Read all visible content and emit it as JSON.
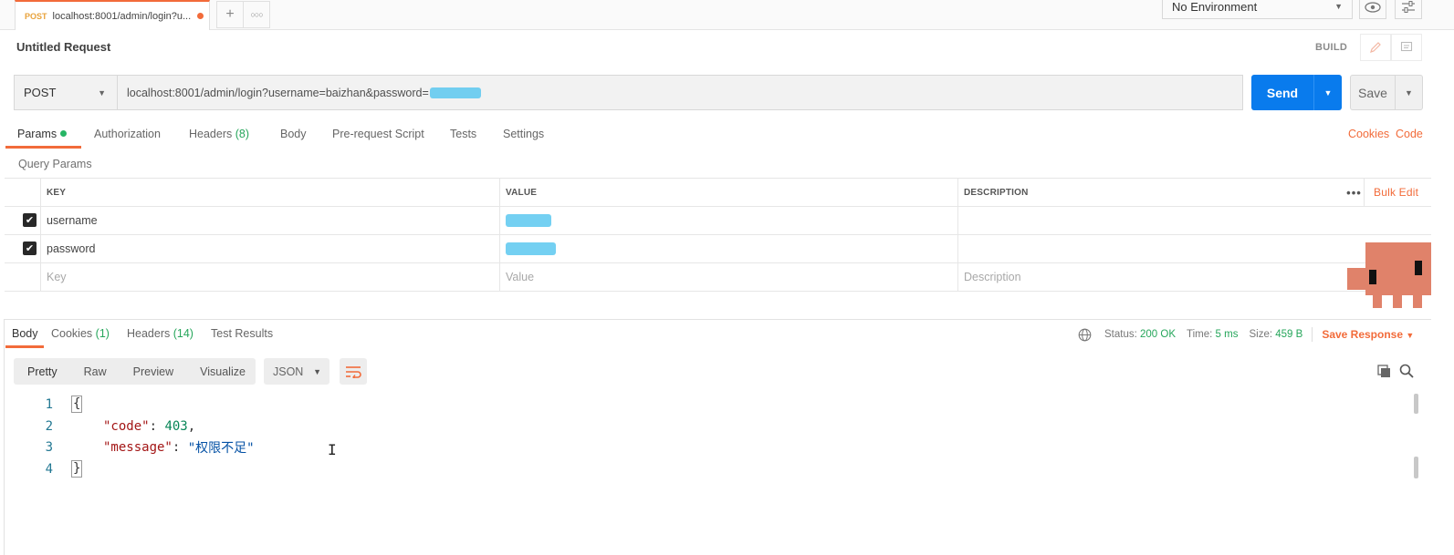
{
  "tabbar": {
    "active_tab": {
      "method": "POST",
      "name": "localhost:8001/admin/login?u..."
    },
    "new_tab_icon": "plus-icon",
    "more_tabs_icon": "ellipsis-icon"
  },
  "environment": {
    "selected": "No Environment"
  },
  "request": {
    "title": "Untitled Request",
    "build_label": "BUILD",
    "method": "POST",
    "url": "localhost:8001/admin/login?username=baizhan&password=",
    "send_label": "Send",
    "save_label": "Save"
  },
  "request_tabs": [
    {
      "label": "Params",
      "active": true,
      "indicator": "green-dot"
    },
    {
      "label": "Authorization"
    },
    {
      "label": "Headers",
      "count": "(8)"
    },
    {
      "label": "Body"
    },
    {
      "label": "Pre-request Script"
    },
    {
      "label": "Tests"
    },
    {
      "label": "Settings"
    }
  ],
  "links": {
    "cookies": "Cookies",
    "code": "Code"
  },
  "query_params": {
    "section_label": "Query Params",
    "columns": {
      "key": "KEY",
      "value": "VALUE",
      "description": "DESCRIPTION"
    },
    "bulk_edit": "Bulk Edit",
    "rows": [
      {
        "checked": true,
        "key": "username",
        "value": "",
        "description": ""
      },
      {
        "checked": true,
        "key": "password",
        "value": "",
        "description": ""
      }
    ],
    "placeholders": {
      "key": "Key",
      "value": "Value",
      "description": "Description"
    }
  },
  "response_tabs": [
    {
      "label": "Body",
      "active": true
    },
    {
      "label": "Cookies",
      "count": "(1)"
    },
    {
      "label": "Headers",
      "count": "(14)"
    },
    {
      "label": "Test Results"
    }
  ],
  "response_status": {
    "status_label": "Status:",
    "status_value": "200 OK",
    "time_label": "Time:",
    "time_value": "5 ms",
    "size_label": "Size:",
    "size_value": "459 B",
    "save_response": "Save Response"
  },
  "response_view": {
    "modes": [
      "Pretty",
      "Raw",
      "Preview",
      "Visualize"
    ],
    "active_mode": "Pretty",
    "format": "JSON"
  },
  "response_body": {
    "line_numbers": [
      "1",
      "2",
      "3",
      "4"
    ],
    "open_brace": "{",
    "close_brace": "}",
    "code_key": "\"code\"",
    "code_value": "403",
    "message_key": "\"message\"",
    "message_value": "\"权限不足\""
  },
  "colors": {
    "accent": "#f26b3a",
    "send": "#097bed",
    "success": "#26a65b"
  }
}
